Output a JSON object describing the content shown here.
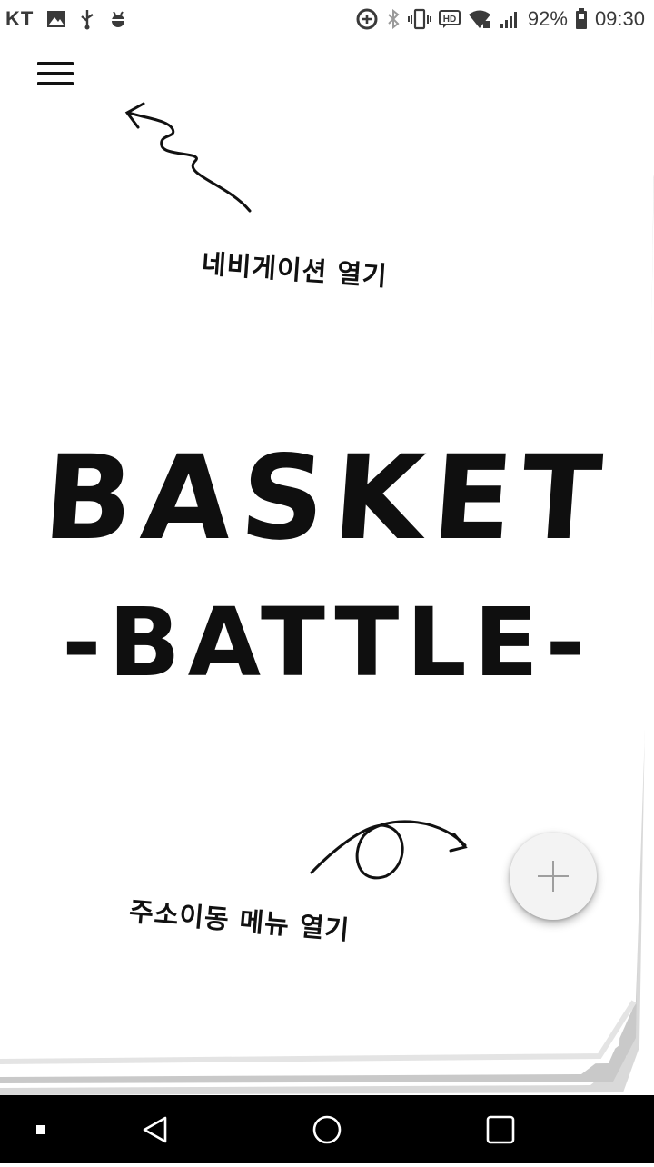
{
  "status_bar": {
    "carrier": "KT",
    "battery_percent": "92%",
    "time": "09:30",
    "left_icons": [
      "gallery-icon",
      "usb-icon",
      "android-debug-icon"
    ],
    "right_icons": [
      "data-saver-icon",
      "bluetooth-icon",
      "vibrate-icon",
      "hd-voice-icon",
      "wifi-icon",
      "signal-icon",
      "battery-icon"
    ]
  },
  "main": {
    "title_line1": "BASKET",
    "title_line2": "-BATTLE-",
    "hint_navigation": "네비게이션 열기",
    "hint_fab": "주소이동 메뉴 열기",
    "menu_icon": "hamburger-menu-icon",
    "fab_icon": "plus-icon"
  },
  "nav_bar": {
    "buttons": [
      "square-dot-icon",
      "back-triangle-icon",
      "home-circle-icon",
      "recents-square-icon"
    ]
  },
  "colors": {
    "ink": "#111111",
    "paper": "#ffffff",
    "fab": "#f3f3f3",
    "nav_bar": "#000000"
  }
}
